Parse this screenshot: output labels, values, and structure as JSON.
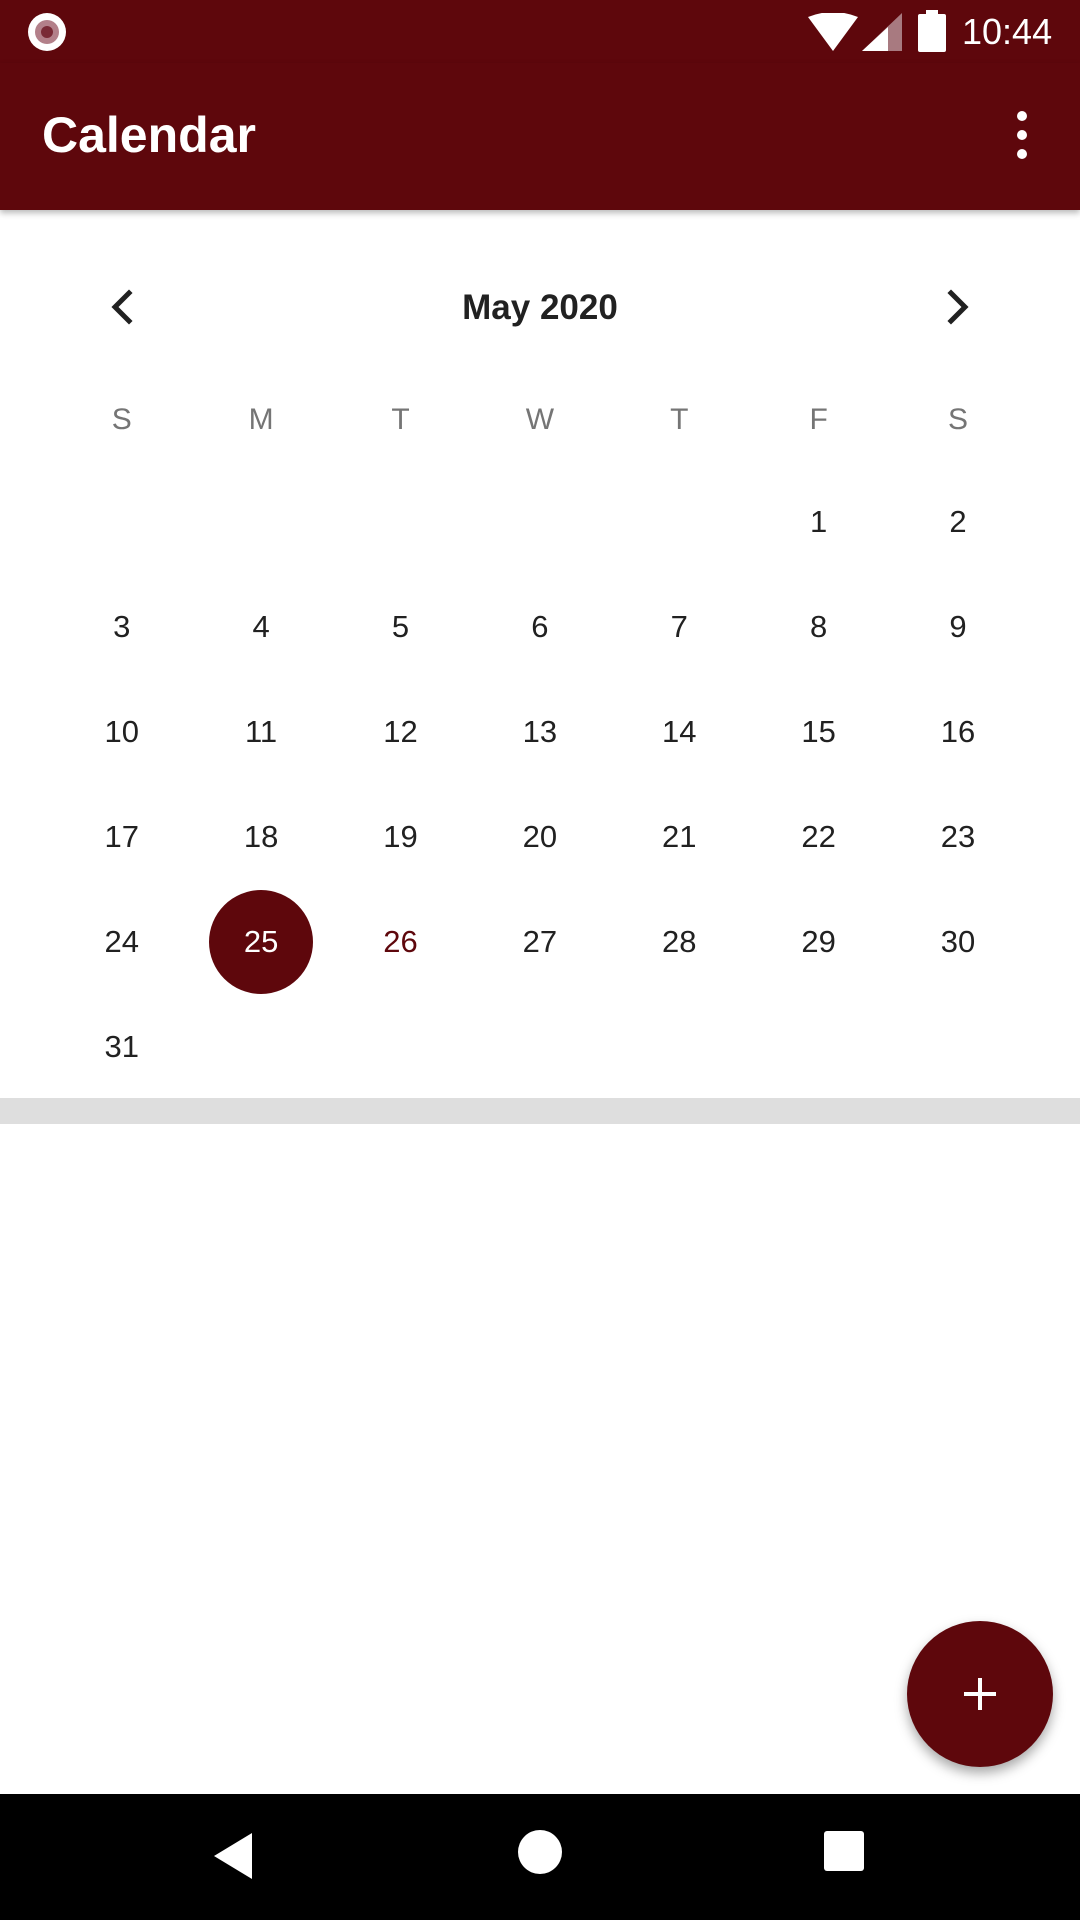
{
  "status_bar": {
    "time": "10:44",
    "icons": [
      "app-notification-icon",
      "wifi-icon",
      "signal-icon",
      "battery-icon"
    ]
  },
  "app_bar": {
    "title": "Calendar",
    "menu_icon": "more-vert-icon"
  },
  "calendar": {
    "month_label": "May 2020",
    "prev_icon": "chevron-left-icon",
    "next_icon": "chevron-right-icon",
    "weekdays": [
      "S",
      "M",
      "T",
      "W",
      "T",
      "F",
      "S"
    ],
    "weeks": [
      [
        "",
        "",
        "",
        "",
        "",
        "1",
        "2"
      ],
      [
        "3",
        "4",
        "5",
        "6",
        "7",
        "8",
        "9"
      ],
      [
        "10",
        "11",
        "12",
        "13",
        "14",
        "15",
        "16"
      ],
      [
        "17",
        "18",
        "19",
        "20",
        "21",
        "22",
        "23"
      ],
      [
        "24",
        "25",
        "26",
        "27",
        "28",
        "29",
        "30"
      ],
      [
        "31",
        "",
        "",
        "",
        "",
        "",
        ""
      ]
    ],
    "selected_day": "25",
    "today": "26"
  },
  "fab": {
    "icon": "add-icon"
  },
  "navigation_bar": {
    "icons": [
      "back-icon",
      "home-icon",
      "recents-icon"
    ]
  },
  "colors": {
    "primary": "#5e070c",
    "background": "#ffffff",
    "divider": "#dedede",
    "weekday_text": "#757575"
  }
}
